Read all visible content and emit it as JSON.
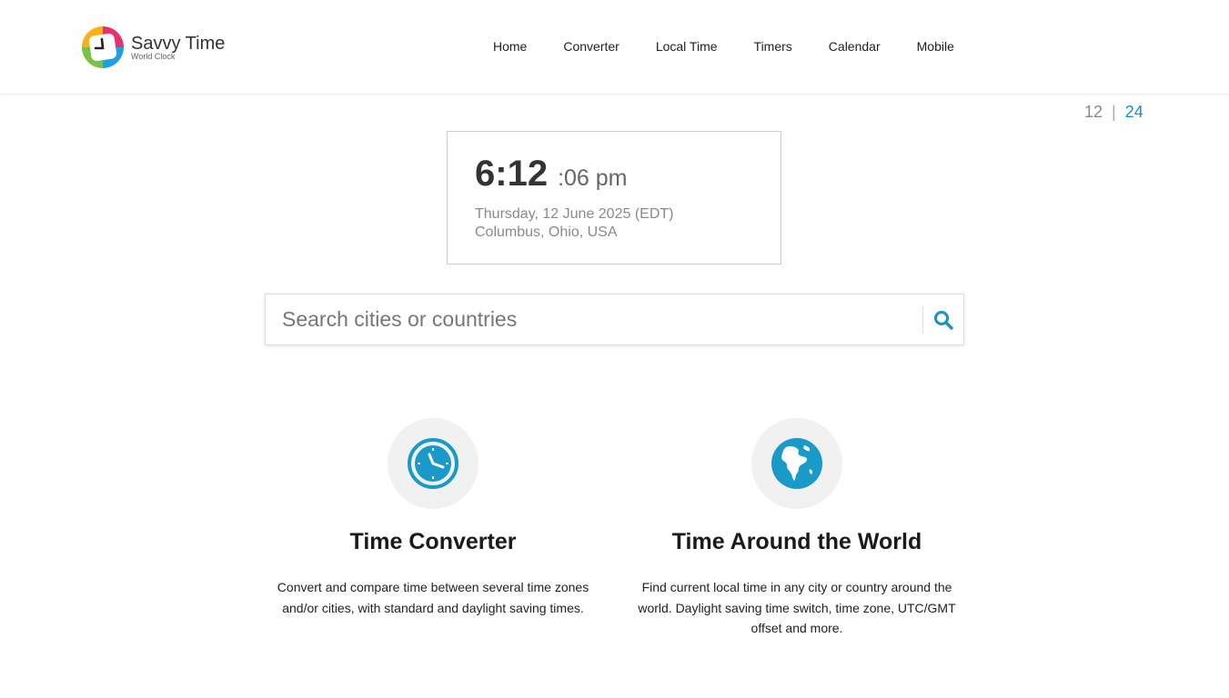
{
  "header": {
    "logo": {
      "title": "Savvy Time",
      "subtitle": "World Clock"
    },
    "nav": [
      {
        "label": "Home"
      },
      {
        "label": "Converter"
      },
      {
        "label": "Local Time"
      },
      {
        "label": "Timers"
      },
      {
        "label": "Calendar"
      },
      {
        "label": "Mobile"
      }
    ]
  },
  "time_format": {
    "option_12": "12",
    "separator": "|",
    "option_24": "24",
    "active": "24"
  },
  "clock": {
    "time": "6:12",
    "seconds_meridiem": ":06 pm",
    "date": "Thursday, 12 June 2025 (EDT)",
    "location": "Columbus, Ohio, USA"
  },
  "search": {
    "placeholder": "Search cities or countries",
    "value": ""
  },
  "features": [
    {
      "title": "Time Converter",
      "description": "Convert and compare time between several time zones and/or cities, with standard and daylight saving times.",
      "icon": "clock-icon"
    },
    {
      "title": "Time Around the World",
      "description": "Find current local time in any city or country around the world. Daylight saving time switch, time zone, UTC/GMT offset and more.",
      "icon": "globe-icon"
    }
  ],
  "colors": {
    "accent": "#1b92c4",
    "icon_blue": "#1a9ac9",
    "icon_bg": "#f1f1f1"
  }
}
